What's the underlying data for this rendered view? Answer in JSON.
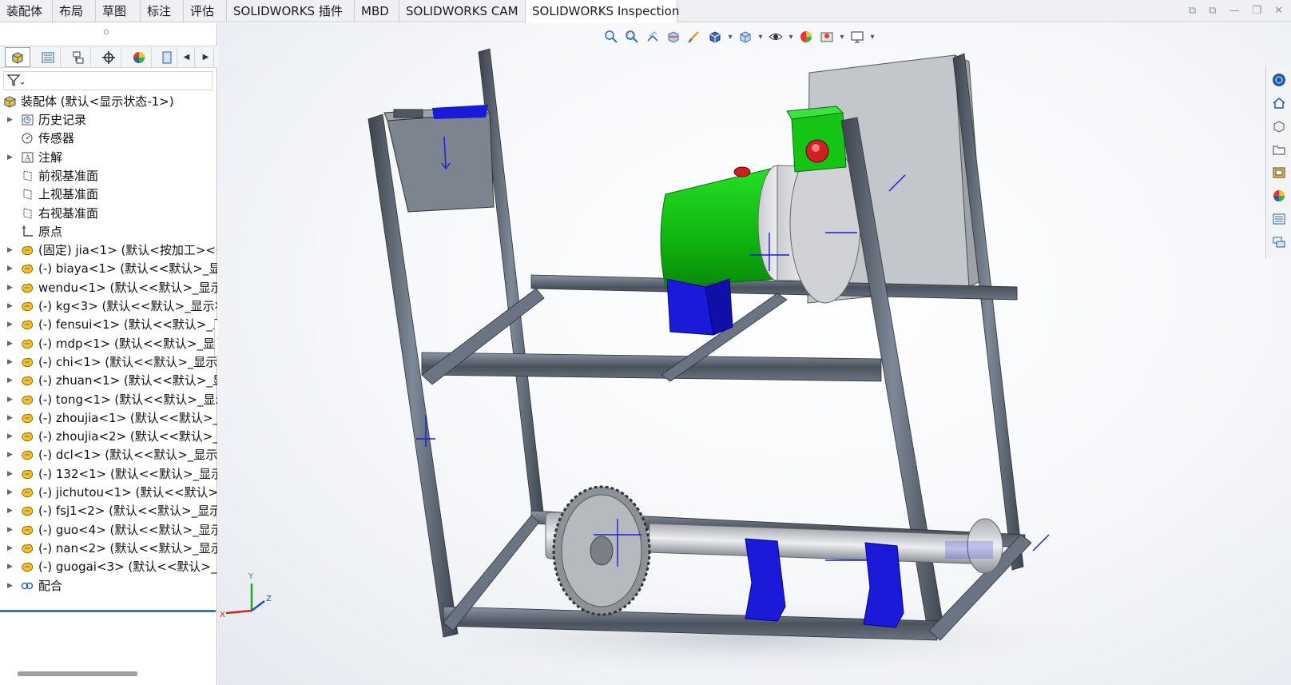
{
  "tabs": [
    "装配体",
    "布局",
    "草图",
    "标注",
    "评估",
    "SOLIDWORKS 插件",
    "MBD",
    "SOLIDWORKS CAM",
    "SOLIDWORKS Inspection"
  ],
  "active_tab_index": 8,
  "feature_tree": {
    "root": "装配体  (默认<显示状态-1>)",
    "items": [
      {
        "label": "历史记录",
        "icon": "history-icon"
      },
      {
        "label": "传感器",
        "icon": "sensor-icon"
      },
      {
        "label": "注解",
        "icon": "annotation-icon"
      },
      {
        "label": "前视基准面",
        "icon": "plane-icon"
      },
      {
        "label": "上视基准面",
        "icon": "plane-icon"
      },
      {
        "label": "右视基准面",
        "icon": "plane-icon"
      },
      {
        "label": "原点",
        "icon": "origin-icon"
      },
      {
        "label": "(固定) jia<1> (默认<按加工><<",
        "icon": "part-icon"
      },
      {
        "label": "(-) biaya<1> (默认<<默认>_显示",
        "icon": "part-icon"
      },
      {
        "label": "wendu<1> (默认<<默认>_显示",
        "icon": "part-icon"
      },
      {
        "label": "(-) kg<3> (默认<<默认>_显示状",
        "icon": "part-icon"
      },
      {
        "label": "(-) fensui<1> (默认<<默认>_显",
        "icon": "part-icon"
      },
      {
        "label": "(-) mdp<1> (默认<<默认>_显示",
        "icon": "part-icon"
      },
      {
        "label": "(-) chi<1> (默认<<默认>_显示状",
        "icon": "part-icon"
      },
      {
        "label": "(-) zhuan<1> (默认<<默认>_显示",
        "icon": "part-icon"
      },
      {
        "label": "(-) tong<1> (默认<<默认>_显示",
        "icon": "part-icon"
      },
      {
        "label": "(-) zhoujia<1> (默认<<默认>_显",
        "icon": "part-icon"
      },
      {
        "label": "(-) zhoujia<2> (默认<<默认>_显",
        "icon": "part-icon"
      },
      {
        "label": "(-) dcl<1> (默认<<默认>_显示状",
        "icon": "part-icon"
      },
      {
        "label": "(-) 132<1> (默认<<默认>_显示状",
        "icon": "part-icon"
      },
      {
        "label": "(-) jichutou<1> (默认<<默认>_",
        "icon": "part-icon"
      },
      {
        "label": "(-) fsj1<2> (默认<<默认>_显示状",
        "icon": "part-icon"
      },
      {
        "label": "(-) guo<4> (默认<<默认>_显示",
        "icon": "part-icon"
      },
      {
        "label": "(-) nan<2> (默认<<默认>_显示状",
        "icon": "part-icon"
      },
      {
        "label": "(-) guogai<3> (默认<<默认>_显",
        "icon": "part-icon"
      },
      {
        "label": "配合",
        "icon": "mate-icon"
      }
    ]
  },
  "triad": {
    "x": "X",
    "y": "Y",
    "z": "Z"
  },
  "colors": {
    "frame": "#5a6270",
    "motor": "#1fcb1f",
    "mount_blue": "#1a1ad8",
    "accent": "#2a7ad1"
  }
}
